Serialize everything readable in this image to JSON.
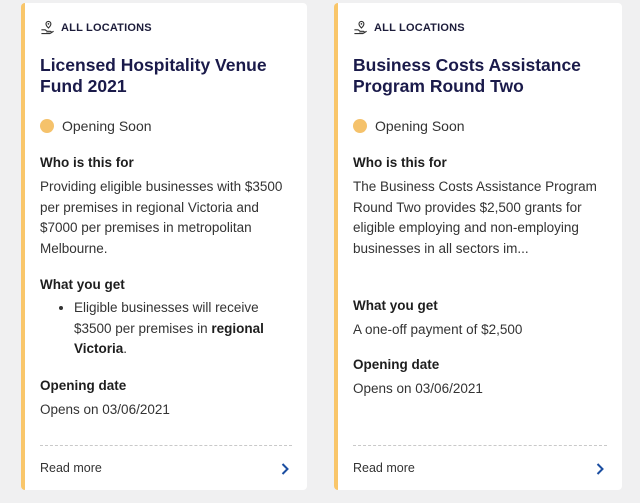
{
  "colors": {
    "accent_border": "#f9c66a",
    "status_dot": "#f5c26b",
    "title": "#1a1a4a",
    "chevron": "#1b4ea1"
  },
  "icons": {
    "location": "location-pin-icon",
    "more": "chevron-right-icon"
  },
  "cards": [
    {
      "location": "ALL LOCATIONS",
      "title": "Licensed Hospitality Venue Fund 2021",
      "status": "Opening Soon",
      "who_heading": "Who is this for",
      "who_text": "Providing eligible businesses with $3500 per premises in regional Victoria and $7000 per premises in metropolitan Melbourne.",
      "get_heading": "What you get",
      "get_bullet_pre": "Eligible businesses will receive $3500 per premises in ",
      "get_bullet_bold": "regional Victoria",
      "get_bullet_post": ".",
      "open_heading": "Opening date",
      "open_text": "Opens on 03/06/2021",
      "read_more": "Read more"
    },
    {
      "location": "ALL LOCATIONS",
      "title": "Business Costs Assistance Program Round Two",
      "status": "Opening Soon",
      "who_heading": "Who is this for",
      "who_text": "The Business Costs Assistance Program Round Two provides $2,500 grants for eligible employing and non-employing businesses in all sectors im...",
      "get_heading": "What you get",
      "get_text": "A one-off payment of $2,500",
      "open_heading": "Opening date",
      "open_text": "Opens on 03/06/2021",
      "read_more": "Read more"
    }
  ]
}
